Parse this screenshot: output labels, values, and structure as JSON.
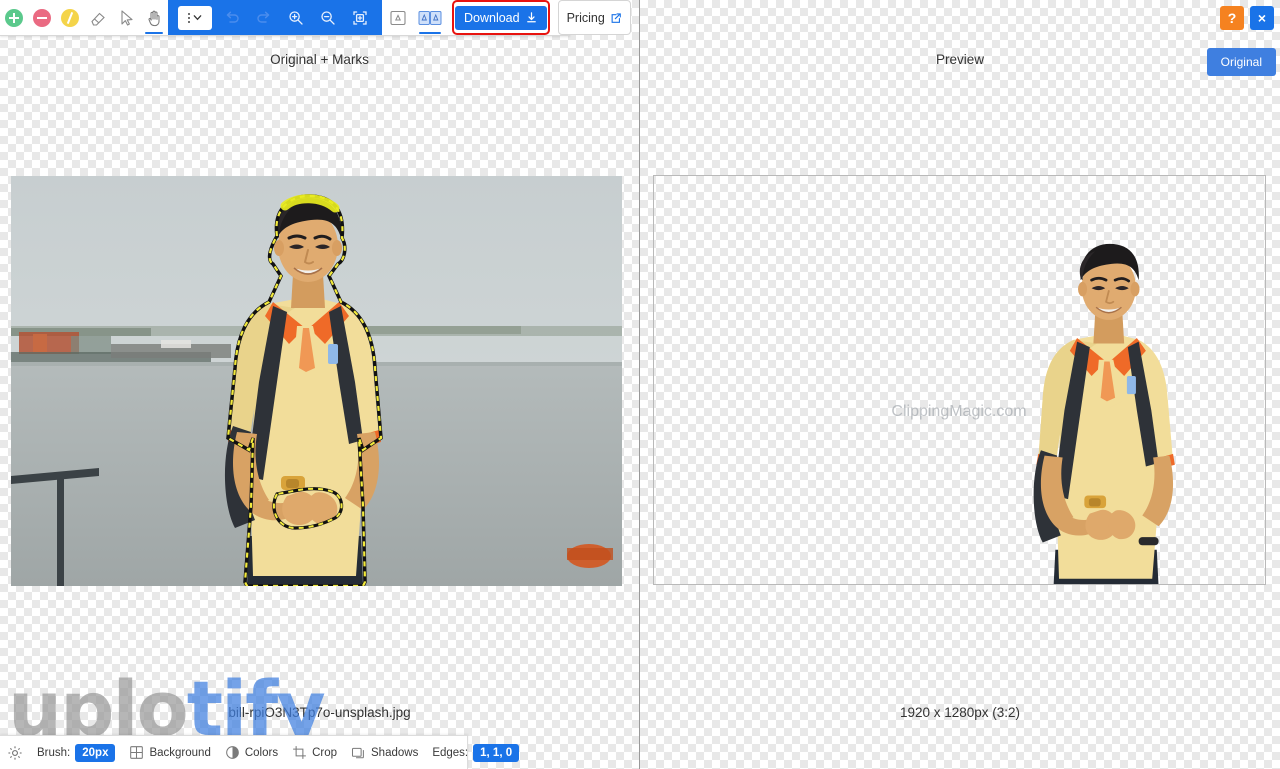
{
  "toolbar": {
    "tools": [
      {
        "name": "add-foreground-tool",
        "icon": "green-plus-circle-icon",
        "title": "Add"
      },
      {
        "name": "remove-background-tool",
        "icon": "red-minus-circle-icon",
        "title": "Remove"
      },
      {
        "name": "hairline-tool",
        "icon": "yellow-line-circle-icon",
        "title": "Hairline"
      },
      {
        "name": "eraser-tool",
        "icon": "eraser-icon",
        "title": "Eraser"
      },
      {
        "name": "cursor-tool",
        "icon": "cursor-arrow-icon",
        "title": "Select"
      },
      {
        "name": "pan-tool",
        "icon": "hand-icon",
        "title": "Pan"
      }
    ],
    "more_menu_label": "",
    "history": [
      {
        "name": "undo-button",
        "icon": "undo-arrow-icon",
        "enabled": false
      },
      {
        "name": "redo-button",
        "icon": "redo-arrow-icon",
        "enabled": false
      }
    ],
    "zoom": [
      {
        "name": "zoom-in-button",
        "icon": "zoom-in-icon"
      },
      {
        "name": "zoom-out-button",
        "icon": "zoom-out-icon"
      },
      {
        "name": "fit-to-screen-button",
        "icon": "fit-screen-icon"
      }
    ],
    "views": [
      {
        "name": "single-view-button",
        "icon": "single-pane-icon",
        "active": false
      },
      {
        "name": "split-view-button",
        "icon": "split-pane-icon",
        "active": true
      }
    ],
    "download_label": "Download",
    "pricing_label": "Pricing"
  },
  "window_controls": {
    "help_label": "?",
    "close_label": "×",
    "original_label": "Original"
  },
  "panels": {
    "left": {
      "title": "Original + Marks",
      "caption": "bill-rpiO3N3Tp7o-unsplash.jpg"
    },
    "right": {
      "title": "Preview",
      "caption": "1920 x 1280px (3:2)",
      "watermark": "ClippingMagic.com"
    }
  },
  "watermark": {
    "part_gray": "uplo",
    "part_blue": "tify"
  },
  "bottom_bar": {
    "settings_icon": "gear-icon",
    "brush_label": "Brush:",
    "brush_value": "20px",
    "items": [
      {
        "name": "background-button",
        "label": "Background",
        "icon": "grid-squares-icon"
      },
      {
        "name": "colors-button",
        "label": "Colors",
        "icon": "half-circle-contrast-icon"
      },
      {
        "name": "crop-button",
        "label": "Crop",
        "icon": "crop-icon"
      },
      {
        "name": "shadows-button",
        "label": "Shadows",
        "icon": "layers-shadow-icon"
      }
    ],
    "edges_label": "Edges:",
    "edges_value": "1, 1, 0"
  },
  "colors": {
    "accent_blue": "#1a73e8",
    "download_highlight_red": "#e8130f",
    "help_orange": "#f58220",
    "tool_green": "#5bc98c",
    "tool_red": "#ea6a82",
    "tool_yellow": "#f4d44a",
    "original_button_blue": "#3f7fe0"
  }
}
